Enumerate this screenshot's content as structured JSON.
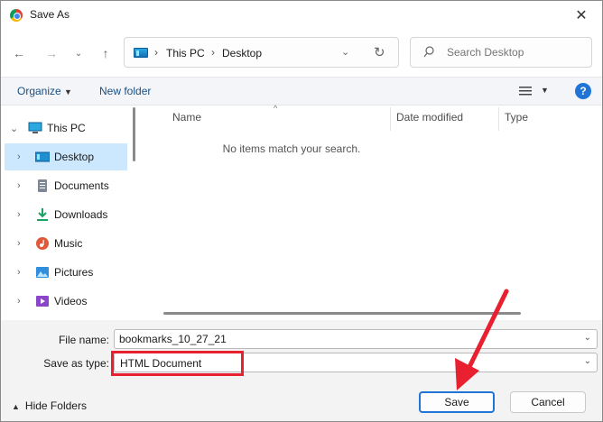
{
  "window": {
    "title": "Save As"
  },
  "address": {
    "crumbs": [
      "This PC",
      "Desktop"
    ]
  },
  "search": {
    "placeholder": "Search Desktop"
  },
  "toolbar": {
    "organize": "Organize",
    "new_folder": "New folder"
  },
  "nav": {
    "items": [
      {
        "label": "This PC",
        "icon": "pc-icon",
        "expanded": true
      },
      {
        "label": "Desktop",
        "icon": "desktop-folder-icon",
        "selected": true
      },
      {
        "label": "Documents",
        "icon": "documents-icon"
      },
      {
        "label": "Downloads",
        "icon": "downloads-icon"
      },
      {
        "label": "Music",
        "icon": "music-icon"
      },
      {
        "label": "Pictures",
        "icon": "pictures-icon"
      },
      {
        "label": "Videos",
        "icon": "videos-icon"
      }
    ]
  },
  "list": {
    "columns": [
      "Name",
      "Date modified",
      "Type"
    ],
    "empty_message": "No items match your search."
  },
  "form": {
    "file_name_label": "File name:",
    "file_name_value": "bookmarks_10_27_21",
    "type_label": "Save as type:",
    "type_value": "HTML Document"
  },
  "footer": {
    "hide_folders": "Hide Folders",
    "save": "Save",
    "cancel": "Cancel"
  },
  "colors": {
    "accent": "#1f74d6",
    "highlight": "#e8202f",
    "selection": "#cce8ff"
  }
}
